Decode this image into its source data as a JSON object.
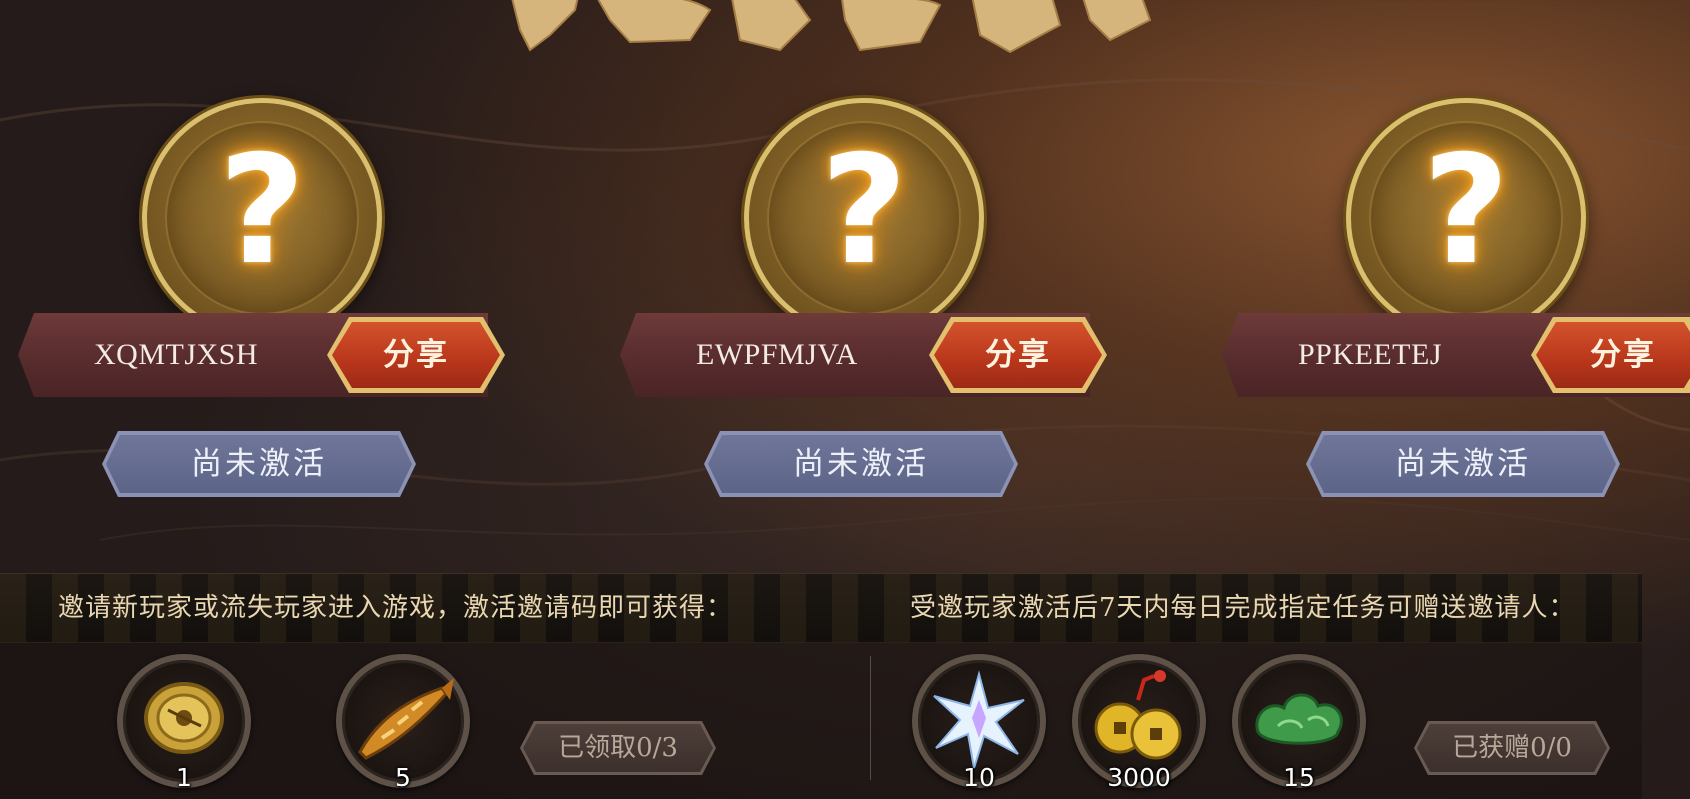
{
  "slots": [
    {
      "code": "XQMTJXSH",
      "share_label": "分享",
      "status_label": "尚未激活"
    },
    {
      "code": "EWPFMJVA",
      "share_label": "分享",
      "status_label": "尚未激活"
    },
    {
      "code": "PPKEETEJ",
      "share_label": "分享",
      "status_label": "尚未激活"
    }
  ],
  "slot_symbol": "?",
  "banner": {
    "left_text": "邀请新玩家或流失玩家进入游戏，激活邀请码即可获得：",
    "right_text": "受邀玩家激活后7天内每日完成指定任务可赠送邀请人："
  },
  "invite_rewards": [
    {
      "icon": "compass-icon",
      "count": "1"
    },
    {
      "icon": "golden-fish-icon",
      "count": "5"
    }
  ],
  "invite_status": "已领取0/3",
  "gift_rewards": [
    {
      "icon": "crystal-star-icon",
      "count": "10"
    },
    {
      "icon": "copper-coins-icon",
      "count": "3000"
    },
    {
      "icon": "jade-cloud-icon",
      "count": "15"
    }
  ],
  "gift_status": "已获赠0/0",
  "colors": {
    "share_red": "#c0401f",
    "gold_border": "#d9bf6e",
    "inactive_blue": "#636b8f",
    "banner_text": "#e9d7b2"
  }
}
